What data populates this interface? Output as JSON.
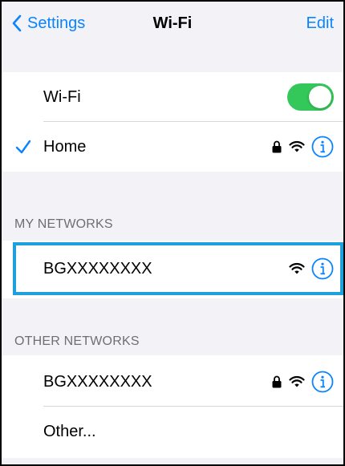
{
  "navbar": {
    "back_label": "Settings",
    "title": "Wi-Fi",
    "edit_label": "Edit"
  },
  "wifi_group": {
    "wifi_label": "Wi-Fi",
    "wifi_enabled": true,
    "connected_network": "Home"
  },
  "my_networks": {
    "header": "MY NETWORKS",
    "items": [
      {
        "name": "BGXXXXXXXX"
      }
    ]
  },
  "other_networks": {
    "header": "OTHER NETWORKS",
    "items": [
      {
        "name": "BGXXXXXXXX"
      }
    ],
    "other_label": "Other..."
  },
  "colors": {
    "accent": "#0a84ff",
    "toggle_on": "#34c759",
    "highlight": "#1ea0dc",
    "background": "#f2f2f7"
  }
}
